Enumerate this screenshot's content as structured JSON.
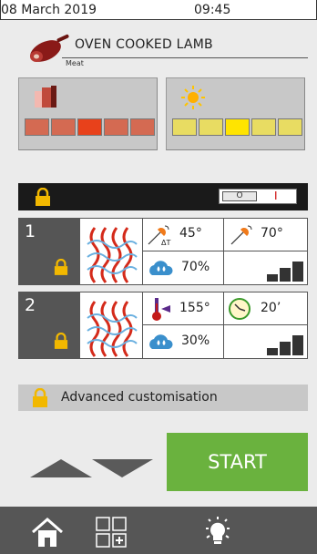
{
  "status": {
    "date": "08 March 2019",
    "time": "09:45"
  },
  "recipe": {
    "title": "OVEN COOKED LAMB",
    "category": "Meat",
    "icon": "meat-icon"
  },
  "cooking_level": {
    "icon": "meat-doneness-icon",
    "segments": 5,
    "selected": 3,
    "color": "#d46a52",
    "active_color": "#e8411b"
  },
  "browning_level": {
    "icon": "sun-icon",
    "segments": 5,
    "selected": 3,
    "color": "#e8dc62",
    "active_color": "#ffe400"
  },
  "lock_toggle": {
    "off_label": "O",
    "on_label": "I",
    "state": "off"
  },
  "phases": [
    {
      "number": "1",
      "mode_icon": "combi-steam-icon",
      "probe_delta_temp": "45°",
      "delta_label": "ΔT",
      "core_temp": "70°",
      "humidity": "70%",
      "fan_speed": 3
    },
    {
      "number": "2",
      "mode_icon": "combi-steam-icon",
      "chamber_temp": "155°",
      "time": "20’",
      "humidity": "30%",
      "fan_speed": 3
    }
  ],
  "advanced": {
    "label": "Advanced customisation"
  },
  "start_label": "START",
  "colors": {
    "accent_green": "#6ab23e",
    "lock_yellow": "#f2b800",
    "nav_bg": "#565656"
  },
  "nav": [
    "home-icon",
    "grid-add-icon",
    "light-bulb-icon"
  ]
}
